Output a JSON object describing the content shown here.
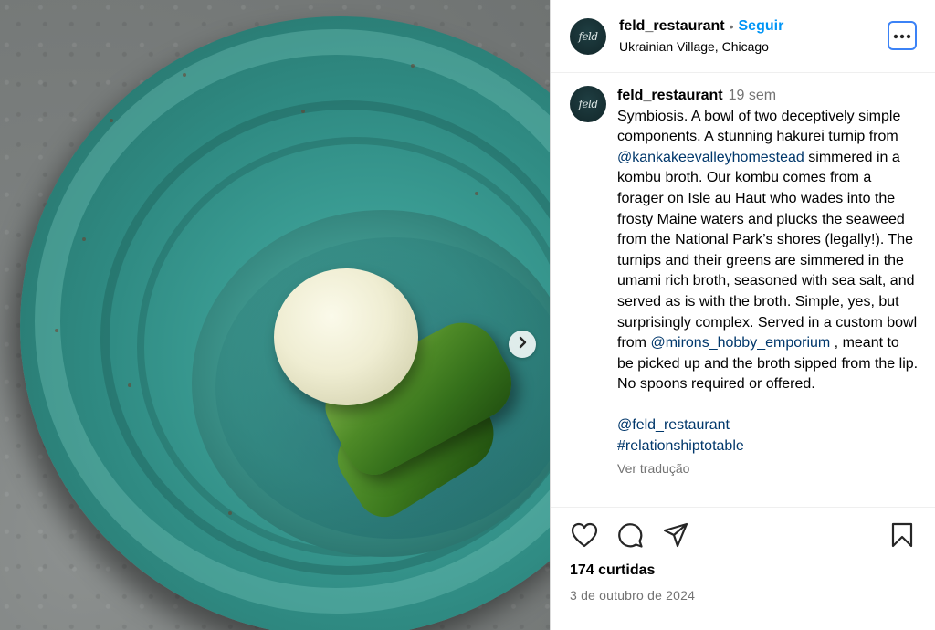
{
  "post": {
    "username": "feld_restaurant",
    "follow_label": "Seguir",
    "separator": "•",
    "location": "Ukrainian Village, Chicago",
    "avatar_text": "feld"
  },
  "caption": {
    "username": "feld_restaurant",
    "time": "19 sem",
    "text_1": "Symbiosis. A bowl of two deceptively simple components. A stunning hakurei turnip from ",
    "mention_1": "@kankakeevalleyhomestead",
    "text_2": " simmered in a kombu broth. Our kombu comes from a forager on Isle au Haut who wades into the frosty Maine waters and plucks the seaweed from the National Park’s shores (legally!). The turnips and their greens are simmered in the umami rich broth, seasoned with sea salt, and served as is with the broth. Simple, yes, but surprisingly complex. Served in a custom bowl from ",
    "mention_2": "@mirons_hobby_emporium",
    "text_3": " , meant to be picked up and the broth sipped from the lip. No spoons required or offered.",
    "mention_3": "@feld_restaurant",
    "hashtag": "#relationshiptotable",
    "translate_label": "Ver tradução"
  },
  "footer": {
    "likes": "174 curtidas",
    "date": "3 de outubro de 2024"
  },
  "icons": {
    "more": "more-options-icon",
    "like": "heart-icon",
    "comment": "comment-icon",
    "share": "share-icon",
    "save": "bookmark-icon",
    "next": "chevron-right-icon"
  },
  "colors": {
    "follow": "#0095f6",
    "mention": "#00376b",
    "secondary_text": "#737373",
    "focus_ring": "#3b82f6"
  }
}
